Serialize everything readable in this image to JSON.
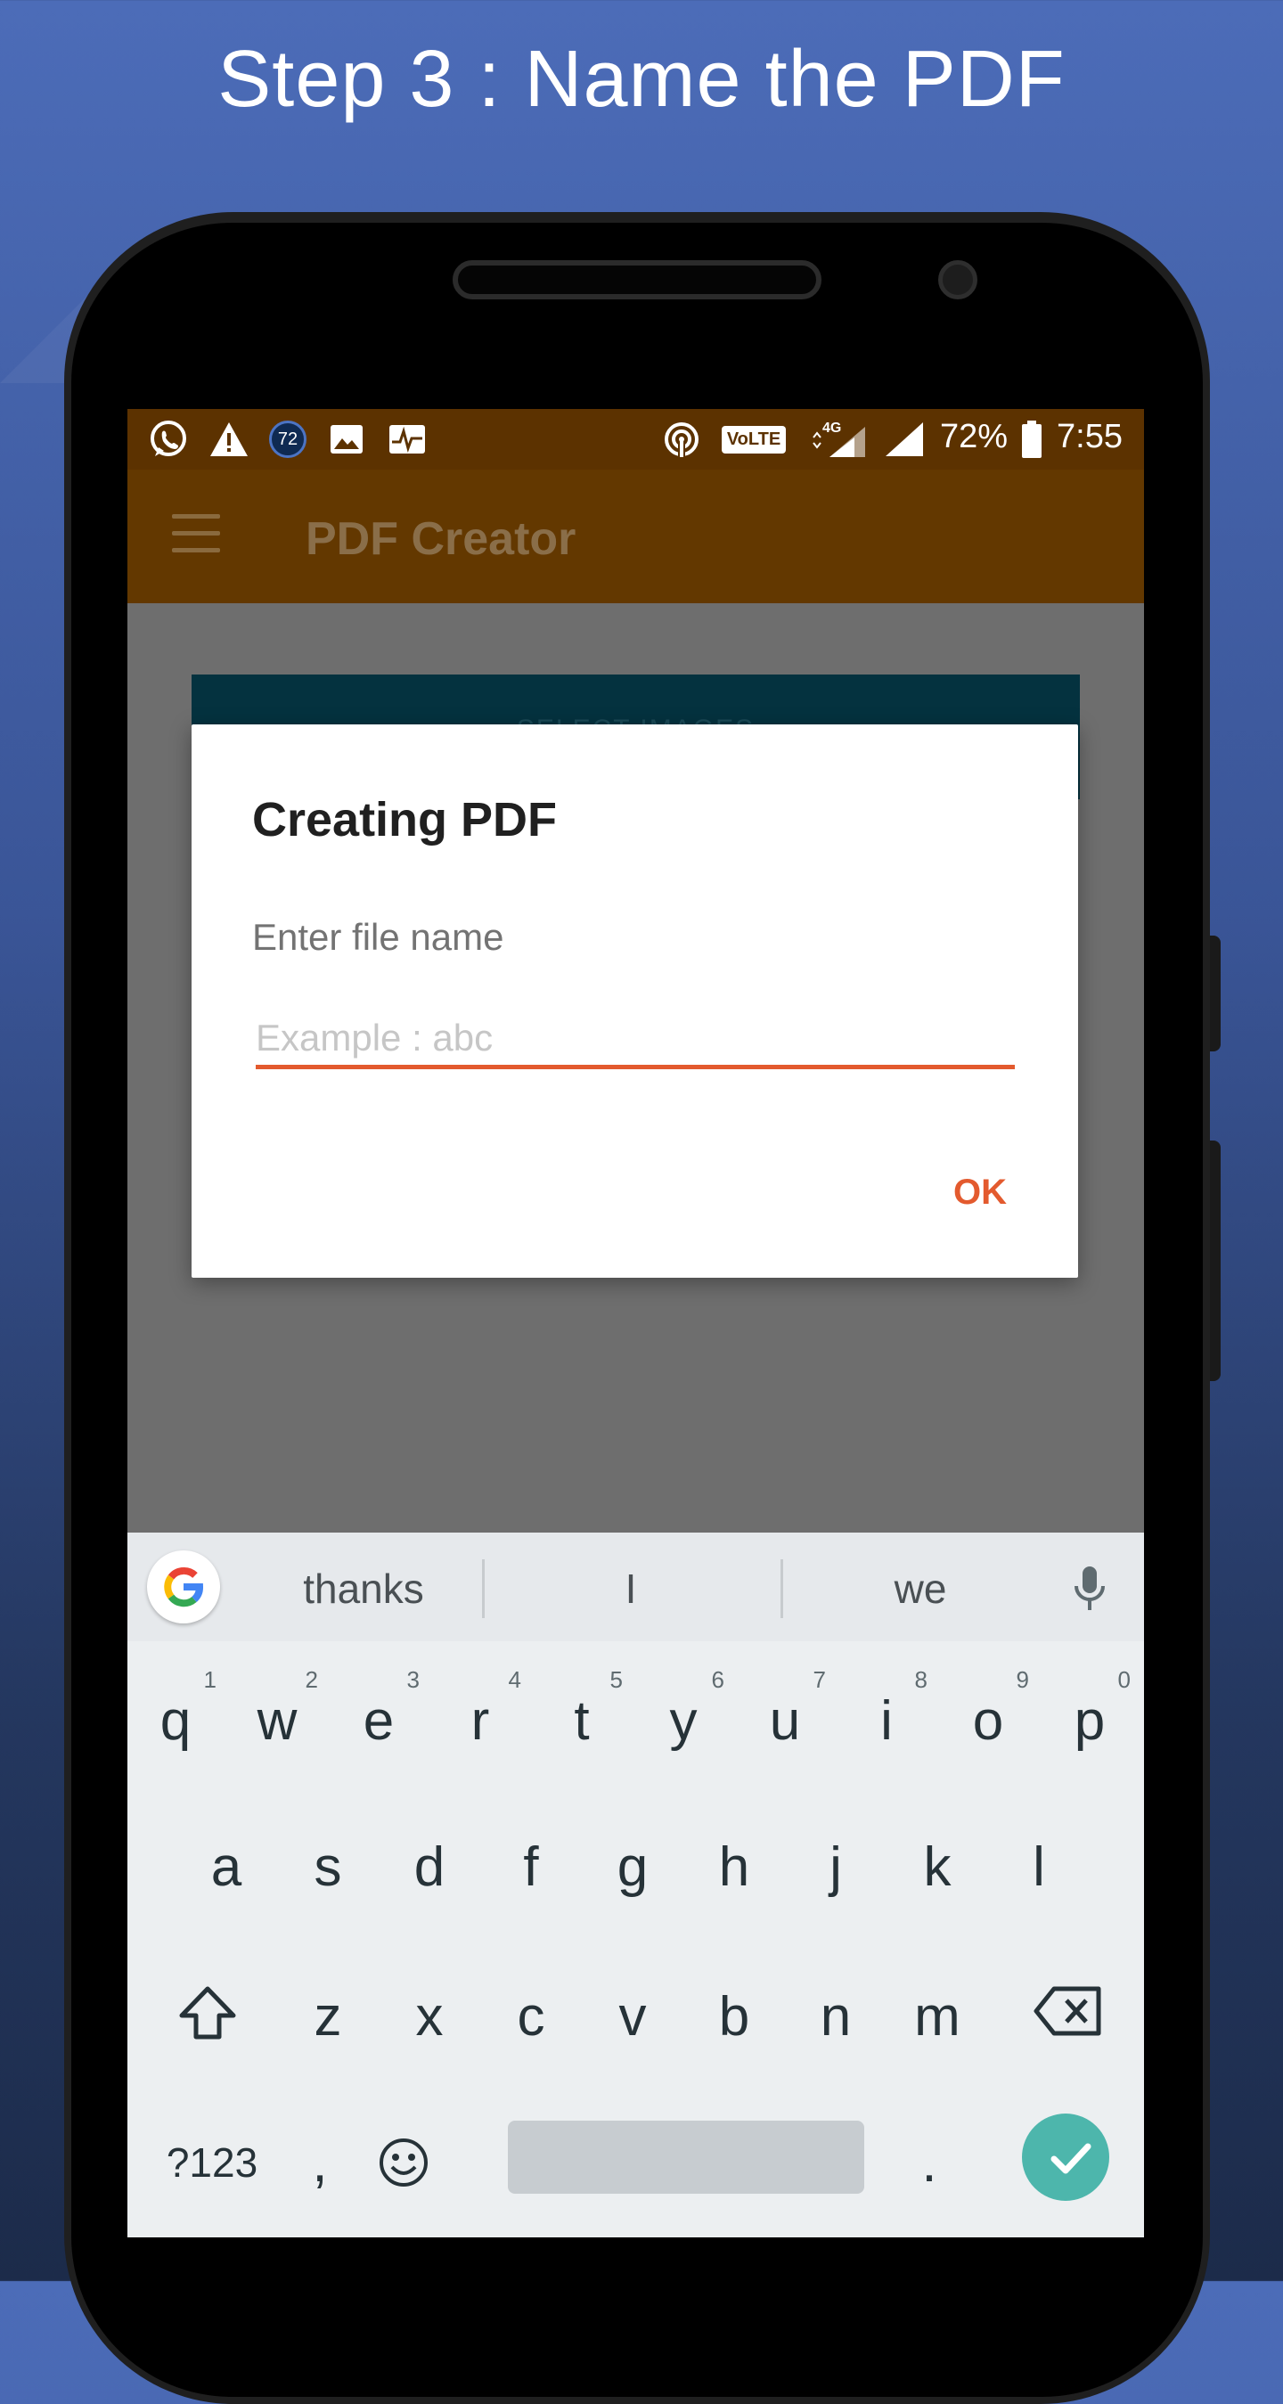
{
  "headline": "Step 3 : Name the PDF",
  "status_bar": {
    "notification_badge": "72",
    "network": "4G",
    "volte": "VoLTE",
    "battery": "72%",
    "time": "7:55"
  },
  "app_bar": {
    "title": "PDF Creator"
  },
  "background_card": {
    "label": "SELECT IMAGES"
  },
  "dialog": {
    "title": "Creating PDF",
    "message": "Enter file name",
    "input_value": "",
    "input_placeholder": "Example : abc",
    "ok_label": "OK"
  },
  "keyboard": {
    "suggestions": [
      "thanks",
      "I",
      "we"
    ],
    "row1": [
      {
        "key": "q",
        "hint": "1"
      },
      {
        "key": "w",
        "hint": "2"
      },
      {
        "key": "e",
        "hint": "3"
      },
      {
        "key": "r",
        "hint": "4"
      },
      {
        "key": "t",
        "hint": "5"
      },
      {
        "key": "y",
        "hint": "6"
      },
      {
        "key": "u",
        "hint": "7"
      },
      {
        "key": "i",
        "hint": "8"
      },
      {
        "key": "o",
        "hint": "9"
      },
      {
        "key": "p",
        "hint": "0"
      }
    ],
    "row2": [
      "a",
      "s",
      "d",
      "f",
      "g",
      "h",
      "j",
      "k",
      "l"
    ],
    "row3": [
      "z",
      "x",
      "c",
      "v",
      "b",
      "n",
      "m"
    ],
    "symbols_label": "?123",
    "comma": ",",
    "period": "."
  },
  "colors": {
    "accent": "#e35a2e",
    "status_bar": "#5c3200",
    "app_bar": "#633800",
    "enter_key": "#4db6ac",
    "background_top": "#4c6cb8",
    "background_bottom": "#1c2b4a"
  },
  "icons": {
    "status_left": [
      "whatsapp-icon",
      "warning-icon",
      "badge-icon",
      "image-icon",
      "activity-icon"
    ],
    "status_right": [
      "hotspot-icon",
      "volte-icon",
      "signal-4g-icon",
      "signal-icon",
      "battery-icon"
    ],
    "keyboard": [
      "google-icon",
      "mic-icon",
      "shift-icon",
      "backspace-icon",
      "emoji-icon",
      "check-icon"
    ]
  }
}
